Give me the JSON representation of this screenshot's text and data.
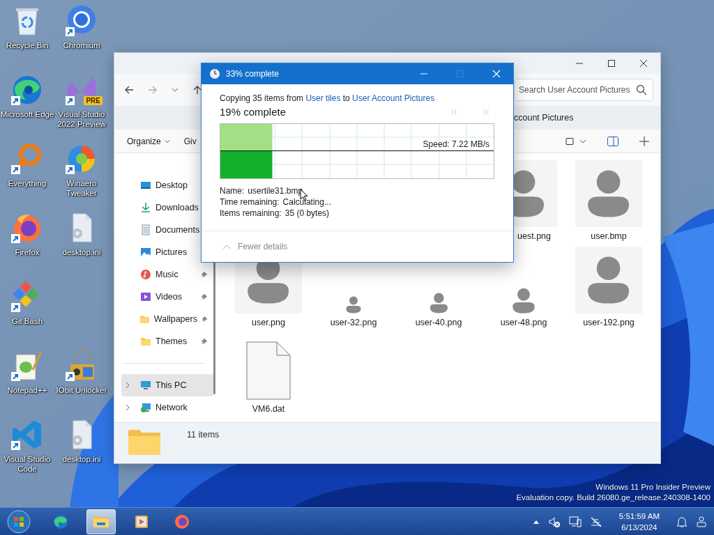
{
  "desktop": {
    "columns": [
      [
        {
          "label": "Recycle Bin",
          "kind": "bin",
          "shortcut": false
        },
        {
          "label": "Microsoft Edge",
          "kind": "edge",
          "shortcut": true
        },
        {
          "label": "Everything",
          "kind": "magnifier",
          "shortcut": true
        },
        {
          "label": "Firefox",
          "kind": "firefox",
          "shortcut": true
        },
        {
          "label": "Git Bash",
          "kind": "git",
          "shortcut": true
        },
        {
          "label": "Notepad++",
          "kind": "notepad",
          "shortcut": true
        },
        {
          "label": "Visual Studio Code",
          "kind": "code",
          "shortcut": true
        }
      ],
      [
        {
          "label": "Chromium",
          "kind": "chromium",
          "shortcut": true
        },
        {
          "label": "Visual Studio 2022 Preview",
          "kind": "studio",
          "shortcut": true,
          "badge": "PRE"
        },
        {
          "label": "Winaero Tweaker",
          "kind": "tweaker",
          "shortcut": true
        },
        {
          "label": "desktop.ini",
          "kind": "settingsfile",
          "shortcut": false
        },
        {
          "label": "IObit Unlocker",
          "kind": "unlocker",
          "shortcut": true
        },
        {
          "label": "desktop.ini",
          "kind": "settingsfile",
          "shortcut": false
        }
      ]
    ]
  },
  "explorer": {
    "search": {
      "placeholder": "Search User Account Pictures"
    },
    "breadcrumb": "ccount Pictures",
    "commands": [
      {
        "label": "Organize",
        "caret": true
      },
      {
        "label": "Giv",
        "caret": false
      }
    ],
    "nav": [
      {
        "label": "Desktop",
        "kind": "desktop",
        "expandable": false,
        "selected": false
      },
      {
        "label": "Downloads",
        "kind": "downloads",
        "expandable": false,
        "selected": false
      },
      {
        "label": "Documents",
        "kind": "documents",
        "expandable": false,
        "selected": false
      },
      {
        "label": "Pictures",
        "kind": "pictures",
        "expandable": false,
        "selected": false
      },
      {
        "label": "Music",
        "kind": "music",
        "pinned": true,
        "expandable": false,
        "selected": false
      },
      {
        "label": "Videos",
        "kind": "videos",
        "pinned": true,
        "expandable": false,
        "selected": false
      },
      {
        "label": "Wallpapers",
        "kind": "folder",
        "pinned": true,
        "expandable": false,
        "selected": false
      },
      {
        "label": "Themes",
        "kind": "folder",
        "pinned": true,
        "expandable": false,
        "selected": false
      },
      {
        "label": "This PC",
        "kind": "pc",
        "pinned": false,
        "expandable": true,
        "selected": true,
        "section": true
      },
      {
        "label": "Network",
        "kind": "network",
        "pinned": false,
        "expandable": true,
        "selected": false
      }
    ],
    "files": [
      {
        "name": "uest.png",
        "kind": "large"
      },
      {
        "name": "user.bmp",
        "kind": "large"
      },
      {
        "name": "user.png",
        "kind": "large"
      },
      {
        "name": "user-32.png",
        "kind": "tiny"
      },
      {
        "name": "user-40.png",
        "kind": "small"
      },
      {
        "name": "user-48.png",
        "kind": "medium"
      },
      {
        "name": "user-192.png",
        "kind": "large"
      },
      {
        "name": "VM6.dat",
        "kind": "file"
      }
    ],
    "status": "11 items"
  },
  "dialog": {
    "title": "33% complete",
    "description": [
      {
        "text": "Copying 35 items from ",
        "kind": "text"
      },
      {
        "text": "User tiles",
        "kind": "link"
      },
      {
        "text": " to ",
        "kind": "text"
      },
      {
        "text": "User Account Pictures",
        "kind": "link"
      }
    ],
    "heading": "19% complete",
    "progress": {
      "level": 0.19,
      "speed": "Speed: 7.22 MB/s"
    },
    "details": [
      {
        "label": "Name:",
        "value": "usertile31.bmp"
      },
      {
        "label": "Time remaining:",
        "value": "Calculating..."
      },
      {
        "label": "Items remaining:",
        "value": "35 (0 bytes)"
      }
    ],
    "toggle": "Fewer details"
  },
  "os_notice": [
    "Windows 11 Pro Insider Preview",
    "Evaluation copy. Build 26080.ge_release.240308-1400"
  ],
  "taskbar": {
    "apps": [
      {
        "kind": "edge",
        "active": false
      },
      {
        "kind": "folder",
        "active": true
      },
      {
        "kind": "player",
        "active": false
      },
      {
        "kind": "firefox",
        "active": false
      }
    ],
    "clock": {
      "time": "5:51:59 AM",
      "date": "6/13/2024"
    }
  }
}
